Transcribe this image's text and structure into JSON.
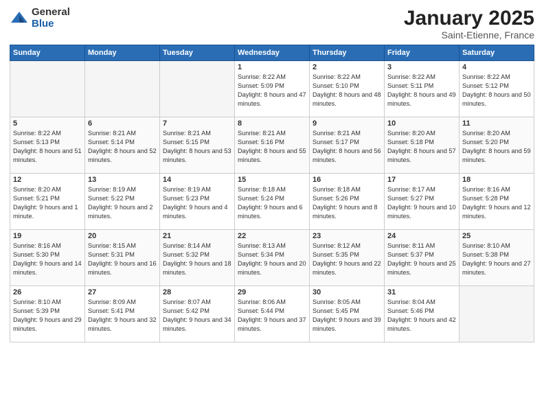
{
  "logo": {
    "general": "General",
    "blue": "Blue"
  },
  "title": "January 2025",
  "location": "Saint-Etienne, France",
  "weekdays": [
    "Sunday",
    "Monday",
    "Tuesday",
    "Wednesday",
    "Thursday",
    "Friday",
    "Saturday"
  ],
  "weeks": [
    [
      {
        "day": "",
        "info": ""
      },
      {
        "day": "",
        "info": ""
      },
      {
        "day": "",
        "info": ""
      },
      {
        "day": "1",
        "info": "Sunrise: 8:22 AM\nSunset: 5:09 PM\nDaylight: 8 hours and 47 minutes."
      },
      {
        "day": "2",
        "info": "Sunrise: 8:22 AM\nSunset: 5:10 PM\nDaylight: 8 hours and 48 minutes."
      },
      {
        "day": "3",
        "info": "Sunrise: 8:22 AM\nSunset: 5:11 PM\nDaylight: 8 hours and 49 minutes."
      },
      {
        "day": "4",
        "info": "Sunrise: 8:22 AM\nSunset: 5:12 PM\nDaylight: 8 hours and 50 minutes."
      }
    ],
    [
      {
        "day": "5",
        "info": "Sunrise: 8:22 AM\nSunset: 5:13 PM\nDaylight: 8 hours and 51 minutes."
      },
      {
        "day": "6",
        "info": "Sunrise: 8:21 AM\nSunset: 5:14 PM\nDaylight: 8 hours and 52 minutes."
      },
      {
        "day": "7",
        "info": "Sunrise: 8:21 AM\nSunset: 5:15 PM\nDaylight: 8 hours and 53 minutes."
      },
      {
        "day": "8",
        "info": "Sunrise: 8:21 AM\nSunset: 5:16 PM\nDaylight: 8 hours and 55 minutes."
      },
      {
        "day": "9",
        "info": "Sunrise: 8:21 AM\nSunset: 5:17 PM\nDaylight: 8 hours and 56 minutes."
      },
      {
        "day": "10",
        "info": "Sunrise: 8:20 AM\nSunset: 5:18 PM\nDaylight: 8 hours and 57 minutes."
      },
      {
        "day": "11",
        "info": "Sunrise: 8:20 AM\nSunset: 5:20 PM\nDaylight: 8 hours and 59 minutes."
      }
    ],
    [
      {
        "day": "12",
        "info": "Sunrise: 8:20 AM\nSunset: 5:21 PM\nDaylight: 9 hours and 1 minute."
      },
      {
        "day": "13",
        "info": "Sunrise: 8:19 AM\nSunset: 5:22 PM\nDaylight: 9 hours and 2 minutes."
      },
      {
        "day": "14",
        "info": "Sunrise: 8:19 AM\nSunset: 5:23 PM\nDaylight: 9 hours and 4 minutes."
      },
      {
        "day": "15",
        "info": "Sunrise: 8:18 AM\nSunset: 5:24 PM\nDaylight: 9 hours and 6 minutes."
      },
      {
        "day": "16",
        "info": "Sunrise: 8:18 AM\nSunset: 5:26 PM\nDaylight: 9 hours and 8 minutes."
      },
      {
        "day": "17",
        "info": "Sunrise: 8:17 AM\nSunset: 5:27 PM\nDaylight: 9 hours and 10 minutes."
      },
      {
        "day": "18",
        "info": "Sunrise: 8:16 AM\nSunset: 5:28 PM\nDaylight: 9 hours and 12 minutes."
      }
    ],
    [
      {
        "day": "19",
        "info": "Sunrise: 8:16 AM\nSunset: 5:30 PM\nDaylight: 9 hours and 14 minutes."
      },
      {
        "day": "20",
        "info": "Sunrise: 8:15 AM\nSunset: 5:31 PM\nDaylight: 9 hours and 16 minutes."
      },
      {
        "day": "21",
        "info": "Sunrise: 8:14 AM\nSunset: 5:32 PM\nDaylight: 9 hours and 18 minutes."
      },
      {
        "day": "22",
        "info": "Sunrise: 8:13 AM\nSunset: 5:34 PM\nDaylight: 9 hours and 20 minutes."
      },
      {
        "day": "23",
        "info": "Sunrise: 8:12 AM\nSunset: 5:35 PM\nDaylight: 9 hours and 22 minutes."
      },
      {
        "day": "24",
        "info": "Sunrise: 8:11 AM\nSunset: 5:37 PM\nDaylight: 9 hours and 25 minutes."
      },
      {
        "day": "25",
        "info": "Sunrise: 8:10 AM\nSunset: 5:38 PM\nDaylight: 9 hours and 27 minutes."
      }
    ],
    [
      {
        "day": "26",
        "info": "Sunrise: 8:10 AM\nSunset: 5:39 PM\nDaylight: 9 hours and 29 minutes."
      },
      {
        "day": "27",
        "info": "Sunrise: 8:09 AM\nSunset: 5:41 PM\nDaylight: 9 hours and 32 minutes."
      },
      {
        "day": "28",
        "info": "Sunrise: 8:07 AM\nSunset: 5:42 PM\nDaylight: 9 hours and 34 minutes."
      },
      {
        "day": "29",
        "info": "Sunrise: 8:06 AM\nSunset: 5:44 PM\nDaylight: 9 hours and 37 minutes."
      },
      {
        "day": "30",
        "info": "Sunrise: 8:05 AM\nSunset: 5:45 PM\nDaylight: 9 hours and 39 minutes."
      },
      {
        "day": "31",
        "info": "Sunrise: 8:04 AM\nSunset: 5:46 PM\nDaylight: 9 hours and 42 minutes."
      },
      {
        "day": "",
        "info": ""
      }
    ]
  ]
}
